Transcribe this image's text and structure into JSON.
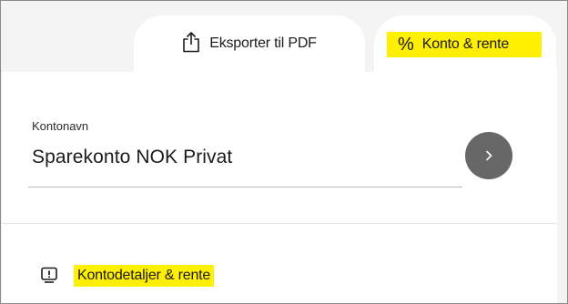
{
  "tabs": {
    "export": {
      "label": "Eksporter til PDF",
      "icon": "share-export-icon"
    },
    "account": {
      "symbol": "%",
      "label": "Konto & rente",
      "highlight_color": "#ffef00"
    }
  },
  "account_field": {
    "label": "Kontonavn",
    "value": "Sparekonto NOK Privat",
    "button_icon": "chevron-right-icon",
    "button_color": "#676767"
  },
  "details": {
    "label": "Kontodetaljer & rente",
    "icon": "info-card-icon",
    "highlight_color": "#ffef00"
  }
}
